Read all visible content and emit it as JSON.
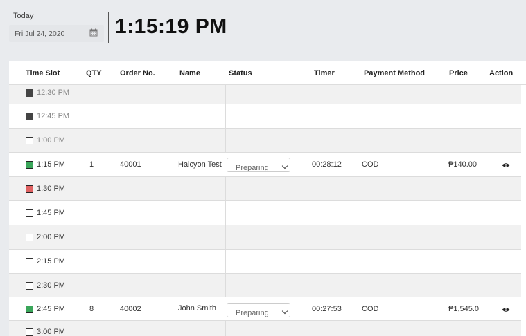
{
  "header": {
    "today_label": "Today",
    "date_value": "Fri Jul 24, 2020",
    "calendar_icon": "calendar-icon",
    "clock": "1:15:19 PM"
  },
  "table": {
    "columns": [
      "Time Slot",
      "QTY",
      "Order No.",
      "Name",
      "Status",
      "Timer",
      "Payment Method",
      "Price",
      "Action"
    ],
    "rows": [
      {
        "slot": "12:30 PM",
        "marker": "dark",
        "muted": true
      },
      {
        "slot": "12:45 PM",
        "marker": "dark",
        "muted": true
      },
      {
        "slot": "1:00 PM",
        "marker": "empty",
        "muted": true
      },
      {
        "slot": "1:15 PM",
        "marker": "green",
        "muted": false,
        "qty": "1",
        "order_no": "40001",
        "name": "Halcyon Test",
        "status": "Preparing",
        "timer": "00:28:12",
        "payment": "COD",
        "price": "₱140.00",
        "action_icon": "eye-icon"
      },
      {
        "slot": "1:30 PM",
        "marker": "red",
        "muted": false
      },
      {
        "slot": "1:45 PM",
        "marker": "empty",
        "muted": false
      },
      {
        "slot": "2:00 PM",
        "marker": "empty",
        "muted": false
      },
      {
        "slot": "2:15 PM",
        "marker": "empty",
        "muted": false
      },
      {
        "slot": "2:30 PM",
        "marker": "empty",
        "muted": false
      },
      {
        "slot": "2:45 PM",
        "marker": "green",
        "muted": false,
        "qty": "8",
        "order_no": "40002",
        "name": "John Smith",
        "status": "Preparing",
        "timer": "00:27:53",
        "payment": "COD",
        "price": "₱1,545.0",
        "action_icon": "eye-icon"
      },
      {
        "slot": "3:00 PM",
        "marker": "empty",
        "muted": false
      }
    ]
  }
}
